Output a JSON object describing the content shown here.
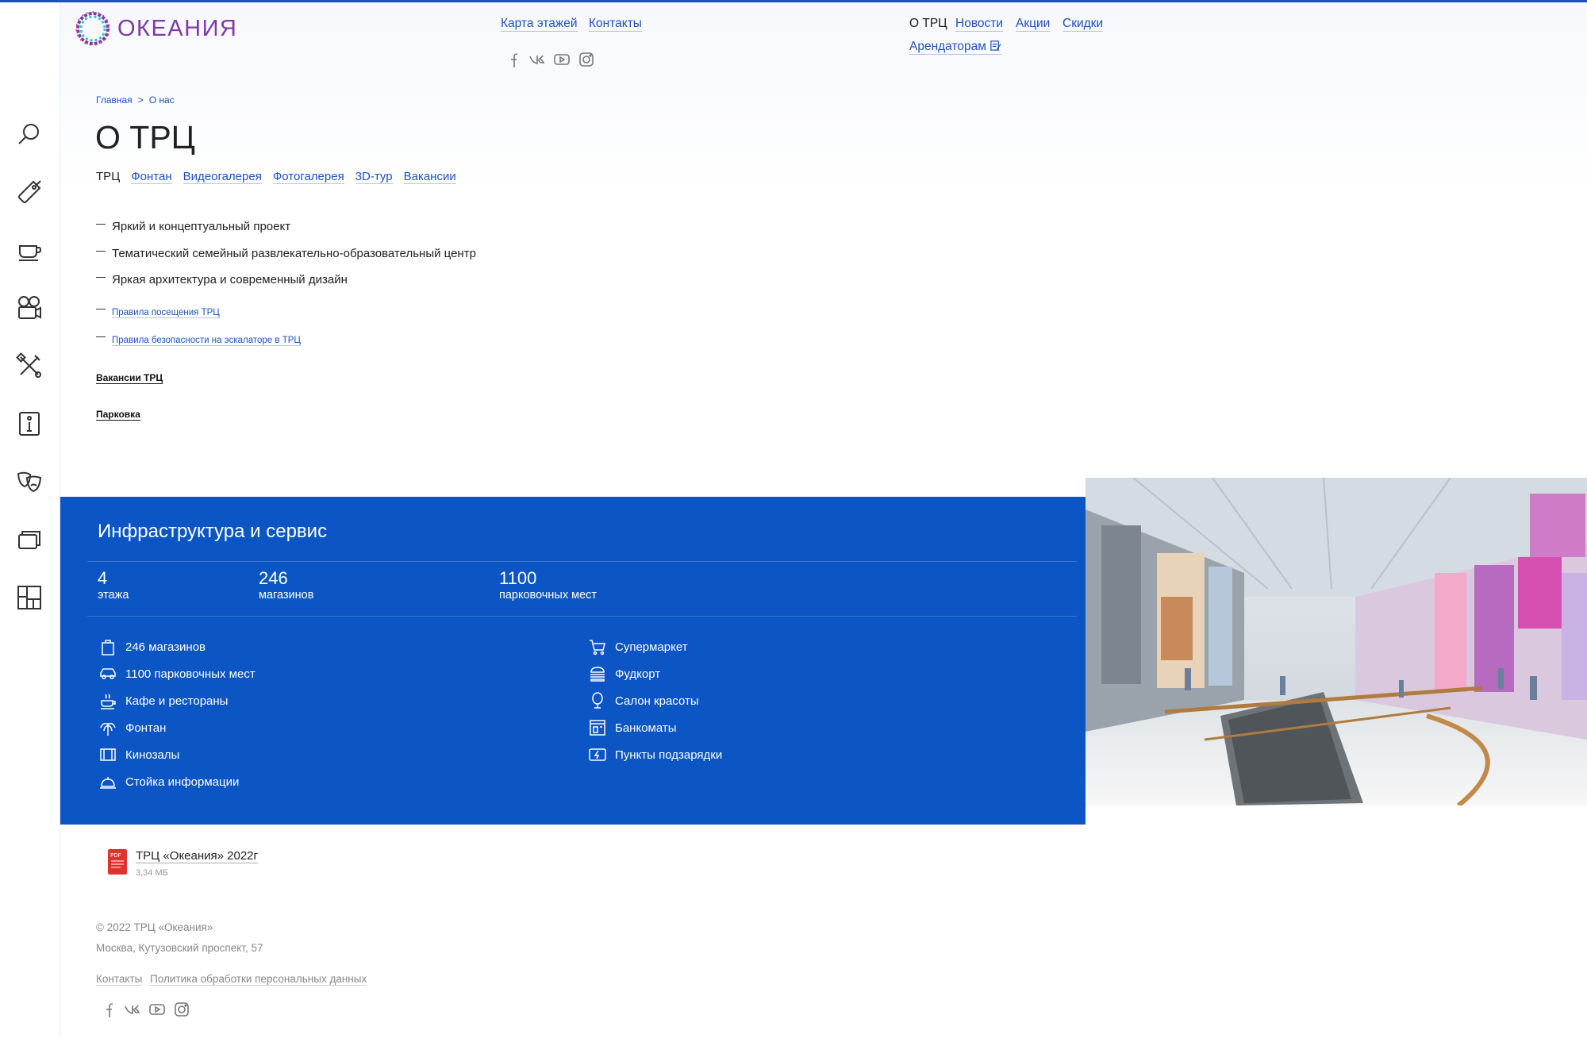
{
  "header": {
    "logo_text": "ОКЕАНИЯ",
    "nav_left": [
      "Карта этажей",
      "Контакты"
    ],
    "nav_right_current": "О ТРЦ",
    "nav_right": [
      "Новости",
      "Акции",
      "Скидки"
    ],
    "tenants_link": "Арендаторам",
    "social_icons": [
      "facebook-icon",
      "vk-icon",
      "youtube-icon",
      "instagram-icon"
    ]
  },
  "sidebar": {
    "icons": [
      "search-icon",
      "tag-icon",
      "cup-icon",
      "movie-camera-icon",
      "tools-icon",
      "info-icon",
      "theater-masks-icon",
      "cards-icon",
      "floor-plan-icon"
    ]
  },
  "breadcrumb": {
    "home": "Главная",
    "separator": ">",
    "current": "О нас"
  },
  "page_title": "О ТРЦ",
  "subtabs": {
    "current": "ТРЦ",
    "links": [
      "Фонтан",
      "Видеогалерея",
      "Фотогалерея",
      "3D-тур",
      "Вакансии"
    ]
  },
  "features": [
    "Яркий и концептуальный проект",
    "Тематический семейный развлекательно-образовательный центр",
    "Яркая архитектура и современный дизайн"
  ],
  "documents": [
    "Правила посещения ТРЦ",
    "Правила безопасности на эскалаторе в ТРЦ"
  ],
  "bold_links": {
    "vacancies": "Вакансии ТРЦ",
    "parking": "Парковка"
  },
  "infrastructure": {
    "title": "Инфраструктура и сервис",
    "stats": [
      {
        "value": "4",
        "label": "этажа"
      },
      {
        "value": "246",
        "label": "магазинов"
      },
      {
        "value": "1100",
        "label": "парковочных мест"
      }
    ],
    "services_left": [
      {
        "icon": "shopping-bag-icon",
        "label": "246 магазинов"
      },
      {
        "icon": "car-icon",
        "label": "1100 парковочных мест"
      },
      {
        "icon": "coffee-icon",
        "label": "Кафе и рестораны"
      },
      {
        "icon": "fountain-icon",
        "label": "Фонтан"
      },
      {
        "icon": "film-icon",
        "label": "Кинозалы"
      },
      {
        "icon": "reception-bell-icon",
        "label": "Стойка информации"
      }
    ],
    "services_right": [
      {
        "icon": "cart-icon",
        "label": "Супермаркет"
      },
      {
        "icon": "burger-icon",
        "label": "Фудкорт"
      },
      {
        "icon": "mirror-icon",
        "label": "Салон красоты"
      },
      {
        "icon": "atm-icon",
        "label": "Банкоматы"
      },
      {
        "icon": "charging-icon",
        "label": "Пункты подзарядки"
      }
    ]
  },
  "pdf": {
    "badge": "PDF",
    "title": "ТРЦ «Океания» 2022г",
    "size": "3,34 МБ"
  },
  "footer": {
    "copyright": "© 2022 ТРЦ «Океания»",
    "address": "Москва, Кутузовский проспект, 57",
    "links": [
      "Контакты",
      "Политика обработки персональных данных"
    ]
  },
  "colors": {
    "brand_blue": "#0b55c4",
    "link_blue": "#1d51c4",
    "logo_purple": "#7f3aa8"
  }
}
